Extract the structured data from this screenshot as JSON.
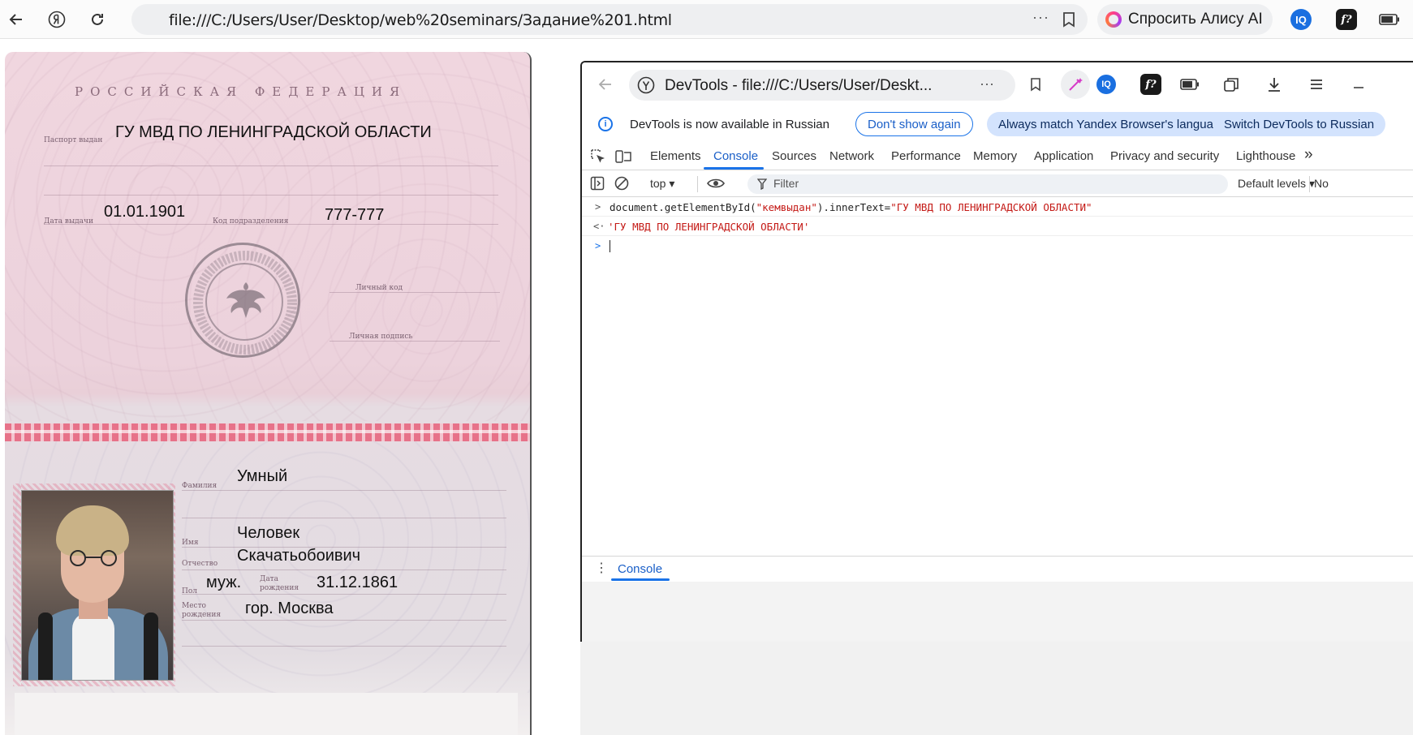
{
  "browser": {
    "url": "file:///C:/Users/User/Desktop/web%20seminars/Задание%201.html",
    "alice_label": "Спросить Алису AI",
    "icons": [
      "back-arrow-icon",
      "yandex-logo-icon",
      "reload-icon",
      "more-dots-icon",
      "bookmark-icon",
      "alice-icon",
      "iq-extension-icon",
      "f-extension-icon",
      "battery-icon"
    ]
  },
  "passport": {
    "header": "РОССИЙСКАЯ ФЕДЕРАЦИЯ",
    "issued_by_label": "Паспорт выдан",
    "issued_by": "ГУ МВД ПО ЛЕНИНГРАДСКОЙ ОБЛАСТИ",
    "issue_date_label": "Дата выдачи",
    "issue_date": "01.01.1901",
    "division_code_label": "Код подразделения",
    "division_code": "777-777",
    "personal_code_label": "Личный код",
    "signature_label": "Личная подпись",
    "surname_label": "Фамилия",
    "surname": "Умный",
    "name_label": "Имя",
    "name": "Человек",
    "patronymic_label": "Отчество",
    "patronymic": "Скачатьобоивич",
    "sex_label": "Пол",
    "sex": "муж.",
    "birth_date_label": "Дата рождения",
    "birth_date": "31.12.1861",
    "birth_place_label": "Место рождения",
    "birth_place": "гор. Москва"
  },
  "devtools": {
    "window_title": "DevTools - file:///C:/Users/User/Deskt...",
    "infobar": {
      "message": "DevTools is now available in Russian",
      "dont_show": "Don't show again",
      "always_match": "Always match Yandex Browser's language",
      "switch": "Switch DevTools to Russian"
    },
    "tabs": [
      "Elements",
      "Console",
      "Sources",
      "Network",
      "Performance",
      "Memory",
      "Application",
      "Privacy and security",
      "Lighthouse"
    ],
    "active_tab": "Console",
    "more_tabs": "»",
    "context": "top",
    "filter_placeholder": "Filter",
    "levels": "Default levels",
    "no_issues": "No",
    "console": {
      "input_line_code": "document.getElementById(",
      "input_line_arg": "\"кемвыдан\"",
      "input_line_mid": ").innerText=",
      "input_line_value": "\"ГУ МВД ПО ЛЕНИНГРАДСКОЙ ОБЛАСТИ\"",
      "result": "'ГУ МВД ПО ЛЕНИНГРАДСКОЙ ОБЛАСТИ'",
      "prompt_in": ">",
      "prompt_out": "<·",
      "prompt_new": ">"
    },
    "drawer_tab": "Console",
    "accent": "#1a73e8",
    "string_color": "#c41a16"
  }
}
